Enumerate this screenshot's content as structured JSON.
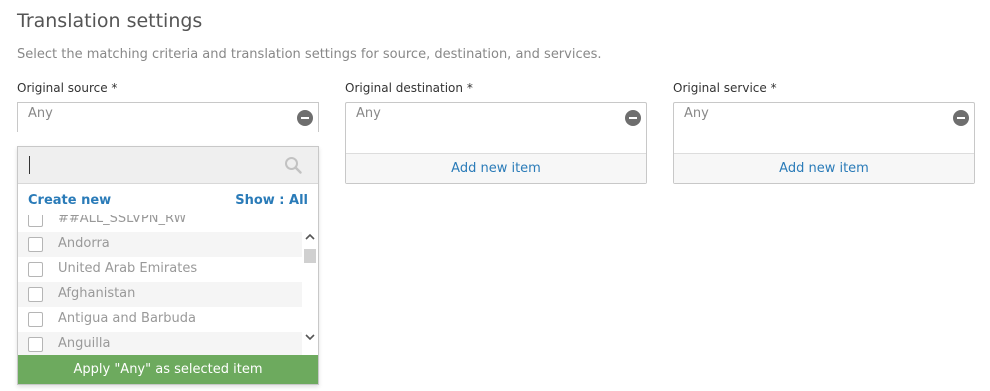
{
  "page": {
    "title": "Translation settings",
    "subtitle": "Select the matching criteria and translation settings for source, destination, and services."
  },
  "source": {
    "label": "Original source *",
    "value": "Any",
    "search_placeholder": "",
    "create_new": "Create new",
    "show_label": "Show : All",
    "items": [
      "##ALL_SSLVPN_RW",
      "Andorra",
      "United Arab Emirates",
      "Afghanistan",
      "Antigua and Barbuda",
      "Anguilla"
    ],
    "apply_label": "Apply \"Any\" as selected item"
  },
  "destination": {
    "label": "Original destination *",
    "value": "Any",
    "add_label": "Add new item"
  },
  "service": {
    "label": "Original service *",
    "value": "Any",
    "add_label": "Add new item"
  },
  "colors": {
    "link": "#2a7bb8",
    "apply_button": "#6daa5e"
  }
}
